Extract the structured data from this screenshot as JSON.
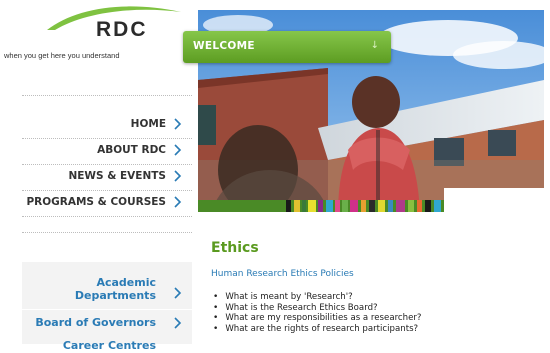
{
  "logo": {
    "text": "RDC",
    "tagline": "when you get here you understand"
  },
  "nav": {
    "items": [
      {
        "label": "HOME"
      },
      {
        "label": "ABOUT RDC"
      },
      {
        "label": "NEWS & EVENTS"
      },
      {
        "label": "PROGRAMS & COURSES"
      }
    ]
  },
  "side_links": {
    "academic_line1": "Academic",
    "academic_line2": "Departments",
    "board": "Board of Governors",
    "career": "Career Centres"
  },
  "hero": {
    "welcome_label": "WELCOME",
    "welcome_icon": "arrow-down-icon"
  },
  "content": {
    "title": "Ethics",
    "subtitle": "Human Research Ethics Policies",
    "bullets": [
      "What is meant by 'Research'?",
      "What is the Research Ethics Board?",
      "What are my responsibilities as a researcher?",
      "What are the rights of research participants?"
    ]
  },
  "colors": {
    "nav_chevron": "#2a7bb5",
    "link_blue": "#2a7bb5",
    "heading_green": "#5a9a1f",
    "welcome_green": "#6aaa2e"
  }
}
